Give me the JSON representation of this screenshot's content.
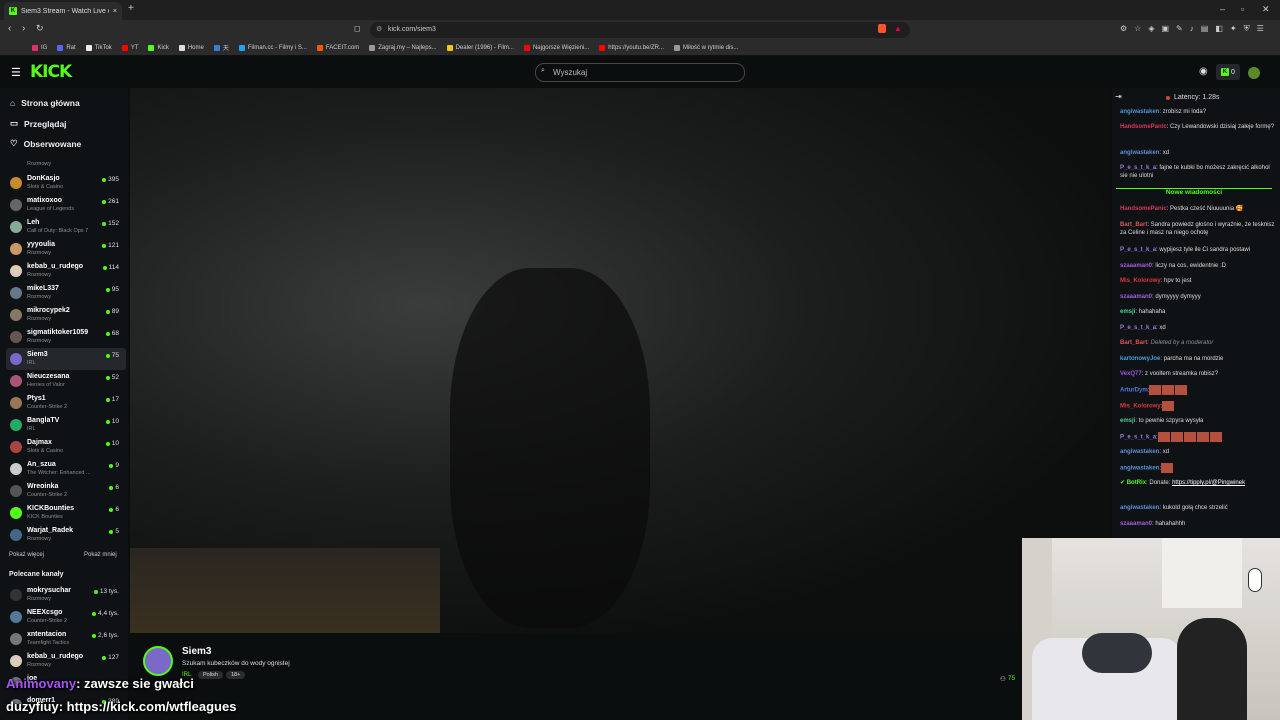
{
  "browser": {
    "tab_title": "Siem3 Stream - Watch Live o",
    "tab_close": "×",
    "new_tab": "+",
    "url": "kick.com/siem3",
    "bookmarks": [
      {
        "label": "IG",
        "color": "#e1306c"
      },
      {
        "label": "Rat",
        "color": "#5865f2"
      },
      {
        "label": "TikTok",
        "color": "#111"
      },
      {
        "label": "YT",
        "color": "#ff0000"
      },
      {
        "label": "Kick",
        "color": "#53fc18"
      },
      {
        "label": "Home",
        "color": "#000"
      },
      {
        "label": "天",
        "color": "#3a7bd5"
      },
      {
        "label": "Filman.cc - Filmy i S...",
        "color": "#1da1f2"
      },
      {
        "label": "FACEIT.com",
        "color": "#ff5500"
      },
      {
        "label": "Zagraj.my – Najleps...",
        "color": "#999"
      },
      {
        "label": "Dealer (1996) - Film...",
        "color": "#f5c518"
      },
      {
        "label": "Najgorsze Więzieni...",
        "color": "#ff0000"
      },
      {
        "label": "https://youtu.be/ZR...",
        "color": "#ff0000"
      },
      {
        "label": "Miłość w rytmie dis...",
        "color": "#999"
      }
    ]
  },
  "header": {
    "logo": "KICK",
    "search_placeholder": "Wyszukaj",
    "credits": "0"
  },
  "nav": {
    "home": "Strona główna",
    "browse": "Przeglądaj",
    "following": "Obserwowane"
  },
  "following_first_category": "Rozmowy",
  "channels": [
    {
      "name": "DonKasjo",
      "cat": "Slots & Casino",
      "viewers": "395",
      "color": "#c78b2c"
    },
    {
      "name": "matixoxoo",
      "cat": "League of Legends",
      "viewers": "261",
      "color": "#666"
    },
    {
      "name": "Leh",
      "cat": "Call of Duty: Black Ops 7",
      "viewers": "152",
      "color": "#8a9"
    },
    {
      "name": "yyyoulia",
      "cat": "Rozmowy",
      "viewers": "121",
      "color": "#c96"
    },
    {
      "name": "kebab_u_rudego",
      "cat": "Rozmowy",
      "viewers": "114",
      "color": "#dcb"
    },
    {
      "name": "mikeL337",
      "cat": "Rozmowy",
      "viewers": "95",
      "color": "#678"
    },
    {
      "name": "mikrocypek2",
      "cat": "Rozmowy",
      "viewers": "89",
      "color": "#876"
    },
    {
      "name": "sigmatiktoker1059",
      "cat": "Rozmowy",
      "viewers": "68",
      "color": "#655"
    },
    {
      "name": "Siem3",
      "cat": "IRL",
      "viewers": "75",
      "color": "#7b68c9"
    },
    {
      "name": "Nieuczesana",
      "cat": "Heroes of Valor",
      "viewers": "52",
      "color": "#a57"
    },
    {
      "name": "Ptys1",
      "cat": "Counter-Strike 2",
      "viewers": "17",
      "color": "#975"
    },
    {
      "name": "BanglaTV",
      "cat": "IRL",
      "viewers": "10",
      "color": "#2a6"
    },
    {
      "name": "Dajmax",
      "cat": "Slots & Casino",
      "viewers": "10",
      "color": "#a44"
    },
    {
      "name": "An_szua",
      "cat": "The Witcher: Enhanced ...",
      "viewers": "9",
      "color": "#ccc"
    },
    {
      "name": "Wreoinka",
      "cat": "Counter-Strike 2",
      "viewers": "6",
      "color": "#555"
    },
    {
      "name": "KICKBounties",
      "cat": "KICK Bounties",
      "viewers": "6",
      "color": "#53fc18"
    },
    {
      "name": "Warjat_Radek",
      "cat": "Rozmowy",
      "viewers": "5",
      "color": "#468"
    }
  ],
  "show_more": "Pokaż więcej",
  "show_less": "Pokaż mniej",
  "recommended_title": "Polecane kanały",
  "recommended": [
    {
      "name": "mokrysuchar",
      "cat": "Rozmowy",
      "viewers": "13 tys.",
      "color": "#333"
    },
    {
      "name": "NEEXcsgo",
      "cat": "Counter-Strike 2",
      "viewers": "4,4 tys.",
      "color": "#579"
    },
    {
      "name": "xntentacion",
      "cat": "Teamfight Tactics",
      "viewers": "2,6 tys.",
      "color": "#777"
    },
    {
      "name": "kebab_u_rudego",
      "cat": "Rozmowy",
      "viewers": "127",
      "color": "#dcb"
    },
    {
      "name": "joe",
      "cat": "",
      "viewers": "",
      "color": "#777"
    },
    {
      "name": "domerr1",
      "cat": "",
      "viewers": "389",
      "color": "#777"
    }
  ],
  "stream": {
    "streamer": "Siem3",
    "title": "Szukam kubeczków do wody ognistej",
    "category": "IRL",
    "tags": [
      "Polish",
      "18+"
    ],
    "viewers": "75"
  },
  "chat": {
    "latency": "Latency: 1.28s",
    "new_messages": "Nowe wiadomości",
    "messages": [
      {
        "user": "angiwastaken",
        "text": ": zrobisz mi loda?",
        "color": "#5b8fd8"
      },
      {
        "user": "HandsomePanic",
        "text": ": Czy Lewandowski dzisiaj załeje formę?",
        "color": "#d8365b"
      },
      {
        "user": "angiwastaken",
        "text": ": xd",
        "color": "#5b8fd8"
      },
      {
        "user": "P_e_s_t_k_a",
        "text": ": fajne te kubki bo możesz zakręcić alkohol sie nie ulotni",
        "color": "#9b7be0"
      },
      {
        "user": "HandsomePanic",
        "text": ": Pestka cześć Niuuuunia 🥰",
        "color": "#d8365b"
      },
      {
        "user": "Bart_Bart",
        "text": ": Sandra powiedz głośno i wyraźnie, że tesknisz za Celine i masz na niego ochotę",
        "color": "#e0565b"
      },
      {
        "user": "P_e_s_t_k_a",
        "text": ": wypijesz tyle ile Ci sandra postawi",
        "color": "#9b7be0"
      },
      {
        "user": "szaaaman0",
        "text": ": liczy na cos, ewidentnie :D",
        "color": "#a35ee0"
      },
      {
        "user": "Mis_Kolorowy",
        "text": ": hpv to jest",
        "color": "#d83b3b"
      },
      {
        "user": "szaaaman0",
        "text": ": dymyyyy dymyyy",
        "color": "#a35ee0"
      },
      {
        "user": "emsji",
        "text": ": hahahaha",
        "color": "#4ccf9b"
      },
      {
        "user": "P_e_s_t_k_a",
        "text": ": xd",
        "color": "#9b7be0"
      },
      {
        "user": "Bart_Bart",
        "text": ": Deleted by a moderator",
        "color": "#e0565b"
      },
      {
        "user": "kartonowyJoe",
        "text": ": parcha ma na mordzie",
        "color": "#4e9de0"
      },
      {
        "user": "VexQ77",
        "text": ": z vooltem streamka robisz?",
        "color": "#9c59e0"
      },
      {
        "user": "ArturDym",
        "text": ":",
        "color": "#4e7de0"
      },
      {
        "user": "Mis_Kolorowy",
        "text": ":",
        "color": "#d83b3b"
      },
      {
        "user": "emsji",
        "text": ": to pewnie szpyra wysyła",
        "color": "#4ccf9b"
      },
      {
        "user": "P_e_s_t_k_a",
        "text": ":",
        "color": "#9b7be0"
      },
      {
        "user": "angiwastaken",
        "text": ": xd",
        "color": "#5b8fd8"
      },
      {
        "user": "angiwastaken",
        "text": ":",
        "color": "#5b8fd8"
      },
      {
        "user": "BotRix",
        "text": ": Donate: ",
        "color": "#53fc18"
      },
      {
        "user": "angiwastaken",
        "text": ": kukold gołą chce strzelić",
        "color": "#5b8fd8"
      },
      {
        "user": "szaaaman0",
        "text": ": hahahahhh",
        "color": "#a35ee0"
      }
    ],
    "botrix_link": "https://tipply.pl/@Pingwinek"
  },
  "overlay": [
    {
      "user": "Animovany",
      "text": ": zawsze sie gwałci",
      "color": "#a855f7"
    },
    {
      "user": "duzyfiuy",
      "text": ": https://kick.com/wtfleagues",
      "color": "#ffffff"
    }
  ]
}
